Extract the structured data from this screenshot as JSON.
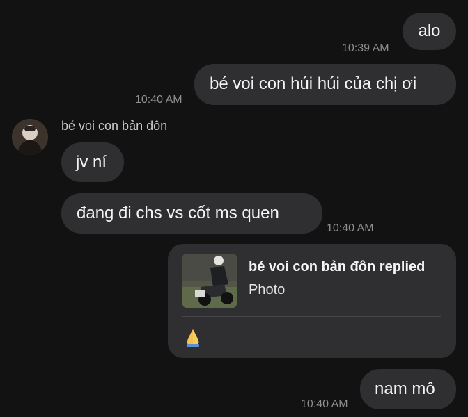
{
  "messages": [
    {
      "id": "m1",
      "text": "alo",
      "time": "10:39 AM",
      "side": "outgoing"
    },
    {
      "id": "m2",
      "text": "bé voi con húi húi của chị ơi",
      "time": "10:40 AM",
      "side": "outgoing"
    },
    {
      "id": "m3",
      "text": "jv ní",
      "side": "incoming"
    },
    {
      "id": "m4",
      "text": "đang đi chs vs cốt ms quen",
      "time": "10:40 AM",
      "side": "incoming"
    },
    {
      "id": "m5",
      "text": "nam mô",
      "time": "10:40 AM",
      "side": "outgoing"
    }
  ],
  "incoming_sender": {
    "name": "bé voi con bản đôn"
  },
  "reply": {
    "title": "bé voi con bản đôn replied",
    "subtitle": "Photo",
    "reaction_icon": "folded-hands-emoji"
  },
  "colors": {
    "background": "#121212",
    "bubble": "#2f2f31",
    "timestamp": "#8e8e93"
  }
}
